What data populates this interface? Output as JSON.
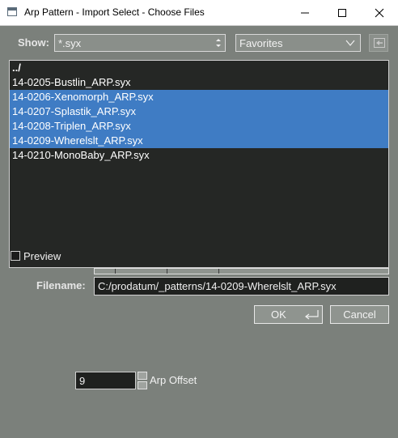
{
  "window": {
    "title": "Arp Pattern - Import Select - Choose Files"
  },
  "toolbar": {
    "show_label": "Show:",
    "filter_value": "*.syx",
    "favorites_value": "Favorites"
  },
  "files": [
    {
      "name": "../",
      "selected": false
    },
    {
      "name": "14-0205-Bustlin_ARP.syx",
      "selected": false
    },
    {
      "name": "14-0206-Xenomorph_ARP.syx",
      "selected": true
    },
    {
      "name": "14-0207-Splastik_ARP.syx",
      "selected": true
    },
    {
      "name": "14-0208-Triplen_ARP.syx",
      "selected": true
    },
    {
      "name": "14-0209-Wherelslt_ARP.syx",
      "selected": true
    },
    {
      "name": "14-0210-MonoBaby_ARP.syx",
      "selected": false
    }
  ],
  "preview": {
    "label": "Preview",
    "checked": false
  },
  "filename": {
    "label": "Filename:",
    "value": "C:/prodatum/_patterns/14-0209-Wherelslt_ARP.syx"
  },
  "buttons": {
    "ok_label": "OK",
    "cancel_label": "Cancel"
  },
  "arp_offset": {
    "value": "9",
    "label": "Arp Offset"
  },
  "colors": {
    "background": "#7b807b",
    "list_background": "#252725",
    "selection": "#3f7cc4"
  }
}
